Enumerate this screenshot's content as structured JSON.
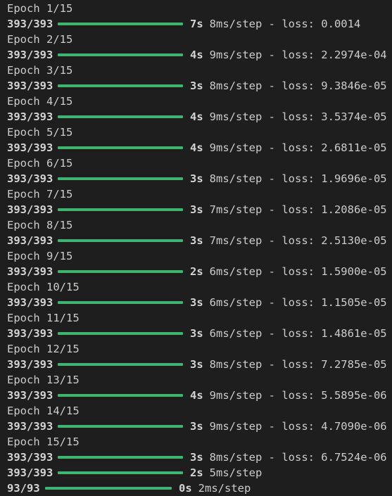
{
  "terminal": {
    "epochs": [
      {
        "label": "Epoch 1/15",
        "step": "393/393",
        "progress": 1.0,
        "time": "7s",
        "rest": "8ms/step - loss: 0.0014"
      },
      {
        "label": "Epoch 2/15",
        "step": "393/393",
        "progress": 1.0,
        "time": "4s",
        "rest": "9ms/step - loss: 2.2974e-04"
      },
      {
        "label": "Epoch 3/15",
        "step": "393/393",
        "progress": 1.0,
        "time": "3s",
        "rest": "8ms/step - loss: 9.3846e-05"
      },
      {
        "label": "Epoch 4/15",
        "step": "393/393",
        "progress": 1.0,
        "time": "4s",
        "rest": "9ms/step - loss: 3.5374e-05"
      },
      {
        "label": "Epoch 5/15",
        "step": "393/393",
        "progress": 1.0,
        "time": "4s",
        "rest": "9ms/step - loss: 2.6811e-05"
      },
      {
        "label": "Epoch 6/15",
        "step": "393/393",
        "progress": 1.0,
        "time": "3s",
        "rest": "8ms/step - loss: 1.9696e-05"
      },
      {
        "label": "Epoch 7/15",
        "step": "393/393",
        "progress": 1.0,
        "time": "3s",
        "rest": "7ms/step - loss: 1.2086e-05"
      },
      {
        "label": "Epoch 8/15",
        "step": "393/393",
        "progress": 1.0,
        "time": "3s",
        "rest": "7ms/step - loss: 2.5130e-05"
      },
      {
        "label": "Epoch 9/15",
        "step": "393/393",
        "progress": 1.0,
        "time": "2s",
        "rest": "6ms/step - loss: 1.5900e-05"
      },
      {
        "label": "Epoch 10/15",
        "step": "393/393",
        "progress": 1.0,
        "time": "3s",
        "rest": "6ms/step - loss: 1.1505e-05"
      },
      {
        "label": "Epoch 11/15",
        "step": "393/393",
        "progress": 1.0,
        "time": "3s",
        "rest": "6ms/step - loss: 1.4861e-05"
      },
      {
        "label": "Epoch 12/15",
        "step": "393/393",
        "progress": 1.0,
        "time": "3s",
        "rest": "8ms/step - loss: 7.2785e-05"
      },
      {
        "label": "Epoch 13/15",
        "step": "393/393",
        "progress": 1.0,
        "time": "4s",
        "rest": "9ms/step - loss: 5.5895e-06"
      },
      {
        "label": "Epoch 14/15",
        "step": "393/393",
        "progress": 1.0,
        "time": "3s",
        "rest": "9ms/step - loss: 4.7090e-06"
      },
      {
        "label": "Epoch 15/15",
        "step": "393/393",
        "progress": 1.0,
        "time": "3s",
        "rest": "8ms/step - loss: 6.7524e-06"
      }
    ],
    "predict_lines": [
      {
        "step": "393/393",
        "progress": 1.0,
        "time": "2s",
        "rest": "5ms/step"
      },
      {
        "step": "93/93",
        "progress": 1.0,
        "time": "0s",
        "rest": "2ms/step"
      }
    ],
    "colors": {
      "background": "#1e1e1e",
      "progress_bar": "#3fb56f",
      "text": "#cccccc"
    }
  }
}
